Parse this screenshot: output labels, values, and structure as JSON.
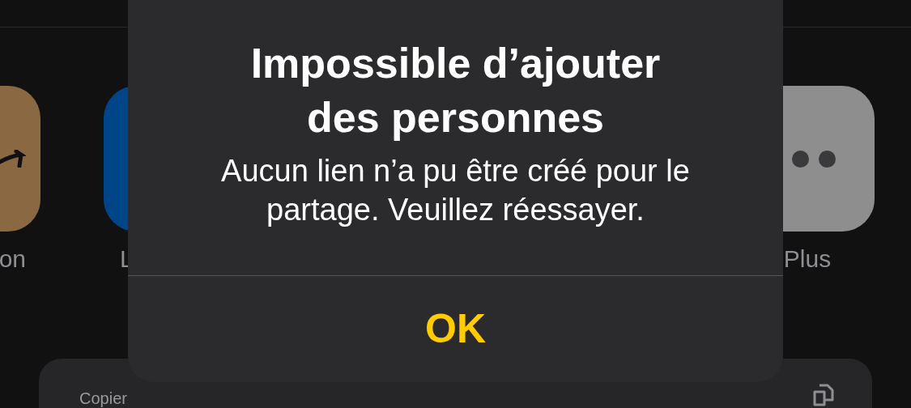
{
  "apps": [
    {
      "kind": "amazon",
      "label": "on"
    },
    {
      "kind": "blue",
      "label": "L"
    },
    {
      "kind": "more",
      "label": "Plus"
    }
  ],
  "action": {
    "label": "Copier"
  },
  "alert": {
    "title": "Impossible d’ajouter des personnes",
    "message": "Aucun lien n’a pu être créé pour le partage. Veuillez réessayer.",
    "button": "OK"
  }
}
